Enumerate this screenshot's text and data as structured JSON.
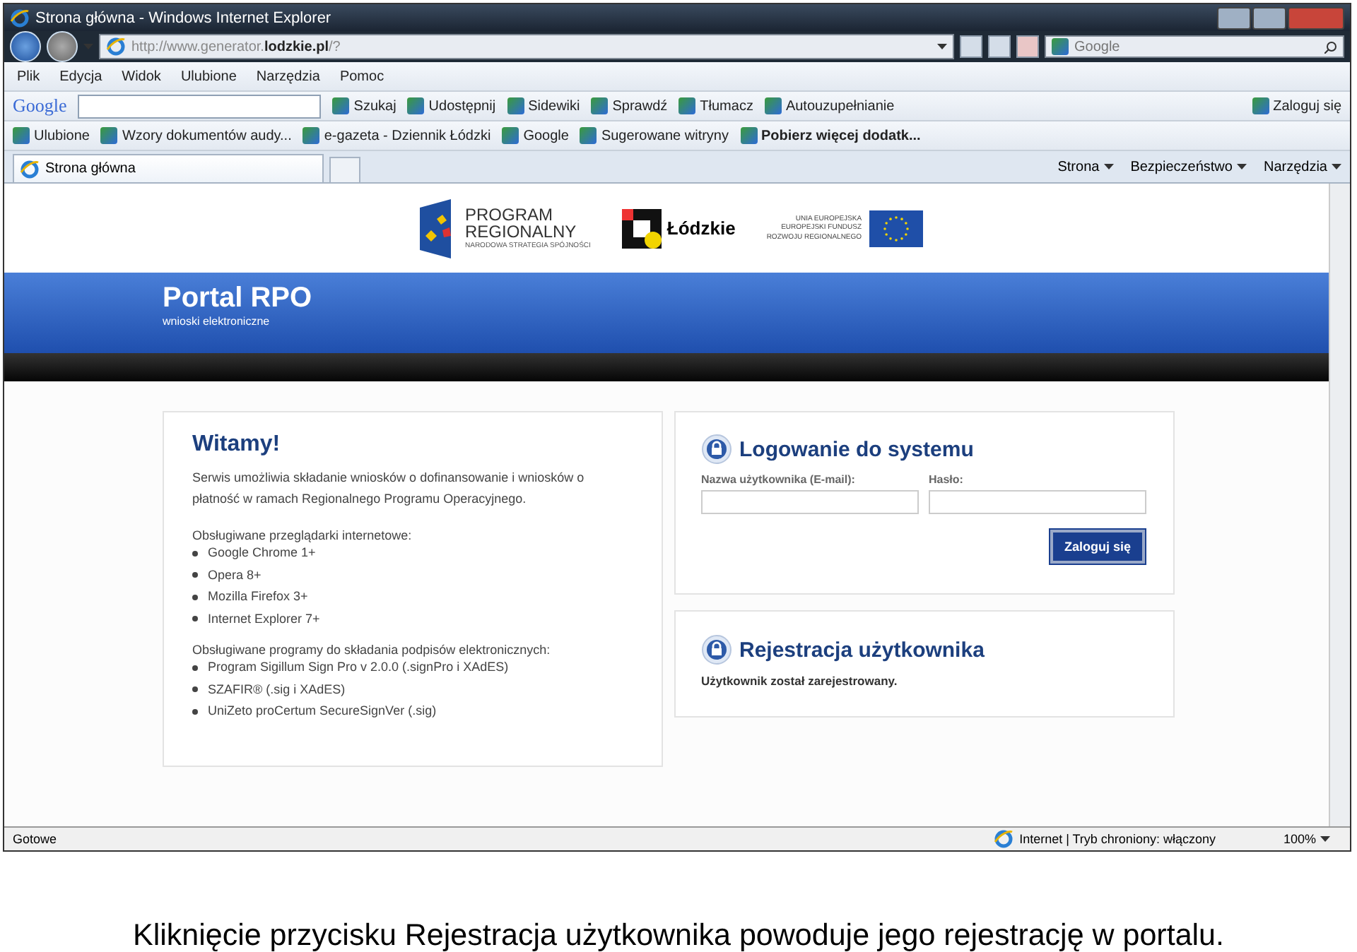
{
  "window": {
    "title": "Strona główna - Windows Internet Explorer"
  },
  "address_bar": {
    "url": "http://www.generator.**lodzkie.pl**/?"
  },
  "search_box": {
    "placeholder": "Google"
  },
  "menu": [
    "Plik",
    "Edycja",
    "Widok",
    "Ulubione",
    "Narzędzia",
    "Pomoc"
  ],
  "google_toolbar": {
    "logo": "Google",
    "items": [
      "Szukaj",
      "Udostępnij",
      "Sidewiki",
      "Sprawdź",
      "Tłumacz",
      "Autouzupełnianie"
    ],
    "sign_in": "Zaloguj się"
  },
  "favorites": [
    {
      "label": "Ulubione",
      "emphasized": false
    },
    {
      "label": "Wzory dokumentów audy...",
      "emphasized": false
    },
    {
      "label": "e-gazeta - Dziennik Łódzki",
      "emphasized": false
    },
    {
      "label": "Google",
      "emphasized": false
    },
    {
      "label": "Sugerowane witryny",
      "emphasized": false
    },
    {
      "label": "Pobierz więcej dodatk...",
      "emphasized": true
    }
  ],
  "tabs": [
    {
      "label": "Strona główna",
      "selected": true
    }
  ],
  "command_bar": [
    "Strona",
    "Bezpieczeństwo",
    "Narzędzia"
  ],
  "page": {
    "logos": {
      "program": [
        "PROGRAM",
        "REGIONALNY"
      ],
      "program_tagline": "NARODOWA STRATEGIA SPÓJNOŚCI",
      "region": "Łódzkie",
      "eu": [
        "UNIA EUROPEJSKA",
        "EUROPEJSKI FUNDUSZ",
        "ROZWOJU REGIONALNEGO"
      ]
    },
    "banner": {
      "title": "Portal RPO",
      "subtitle": "wnioski elektroniczne"
    },
    "welcome": {
      "title": "Witamy!",
      "intro": "Serwis umożliwia składanie wniosków o dofinansowanie i wniosków o płatność w ramach Regionalnego Programu Operacyjnego.",
      "sections": [
        {
          "heading": "Obsługiwane przeglądarki internetowe:",
          "items": [
            "Google Chrome 1+",
            "Opera 8+",
            "Mozilla Firefox 3+",
            "Internet Explorer 7+"
          ]
        },
        {
          "heading": "Obsługiwane programy do składania podpisów elektronicznych:",
          "items": [
            "Program Sigillum Sign Pro v 2.0.0 (.signPro i XAdES)",
            "SZAFIR® (.sig i XAdES)",
            "UniZeto proCertum SecureSignVer (.sig)"
          ]
        }
      ]
    },
    "login": {
      "title": "Logowanie do systemu",
      "fields": [
        {
          "label": "Nazwa użytkownika (E-mail):"
        },
        {
          "label": "Hasło:"
        }
      ],
      "button": "Zaloguj się"
    },
    "registration": {
      "title": "Rejestracja użytkownika",
      "message": "Użytkownik został zarejestrowany."
    }
  },
  "status_bar": {
    "status": "Gotowe",
    "zone": "Internet | Tryb chroniony: włączony",
    "zoom": "100%"
  },
  "caption": "Kliknięcie przycisku Rejestracja użytkownika powoduje jego rejestrację w portalu."
}
